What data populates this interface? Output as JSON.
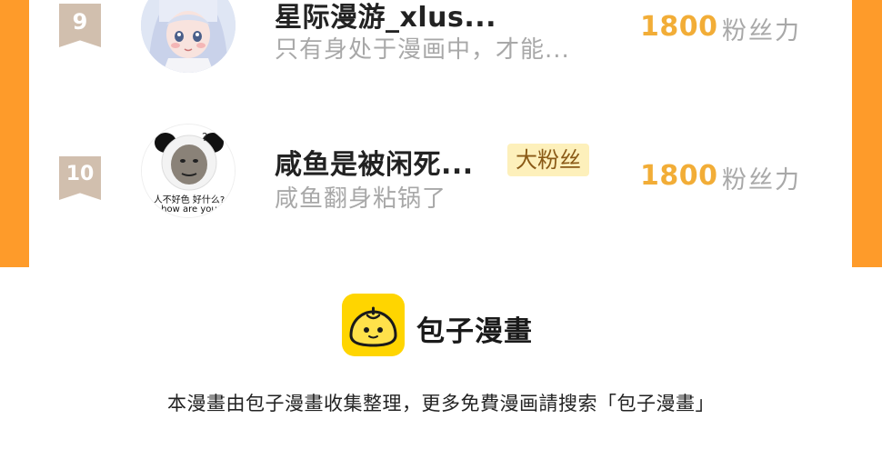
{
  "leaderboard": {
    "rows": [
      {
        "rank": "9",
        "name": "星际漫游_xlus...",
        "bio": "只有身处于漫画中，才能...",
        "badge": "",
        "score": "1800",
        "score_unit": "粉丝力"
      },
      {
        "rank": "10",
        "name": "咸鱼是被闲死...",
        "bio": "咸鱼翻身粘锅了",
        "badge": "大粉丝",
        "score": "1800",
        "score_unit": "粉丝力",
        "avatar_caption_1": "人不好色 好什么?",
        "avatar_caption_2": "how are you"
      }
    ]
  },
  "brand": {
    "name": "包子漫畫",
    "icon": "baozi-logo-icon"
  },
  "footer": {
    "note": "本漫畫由包子漫畫收集整理，更多免費漫画請搜索「包子漫畫」"
  },
  "colors": {
    "accent_orange": "#fe9b2a",
    "score_gold": "#f2ad37",
    "rank_badge": "#d1bfae",
    "fan_badge_bg": "#fdf0bb",
    "logo_yellow": "#ffd500"
  }
}
